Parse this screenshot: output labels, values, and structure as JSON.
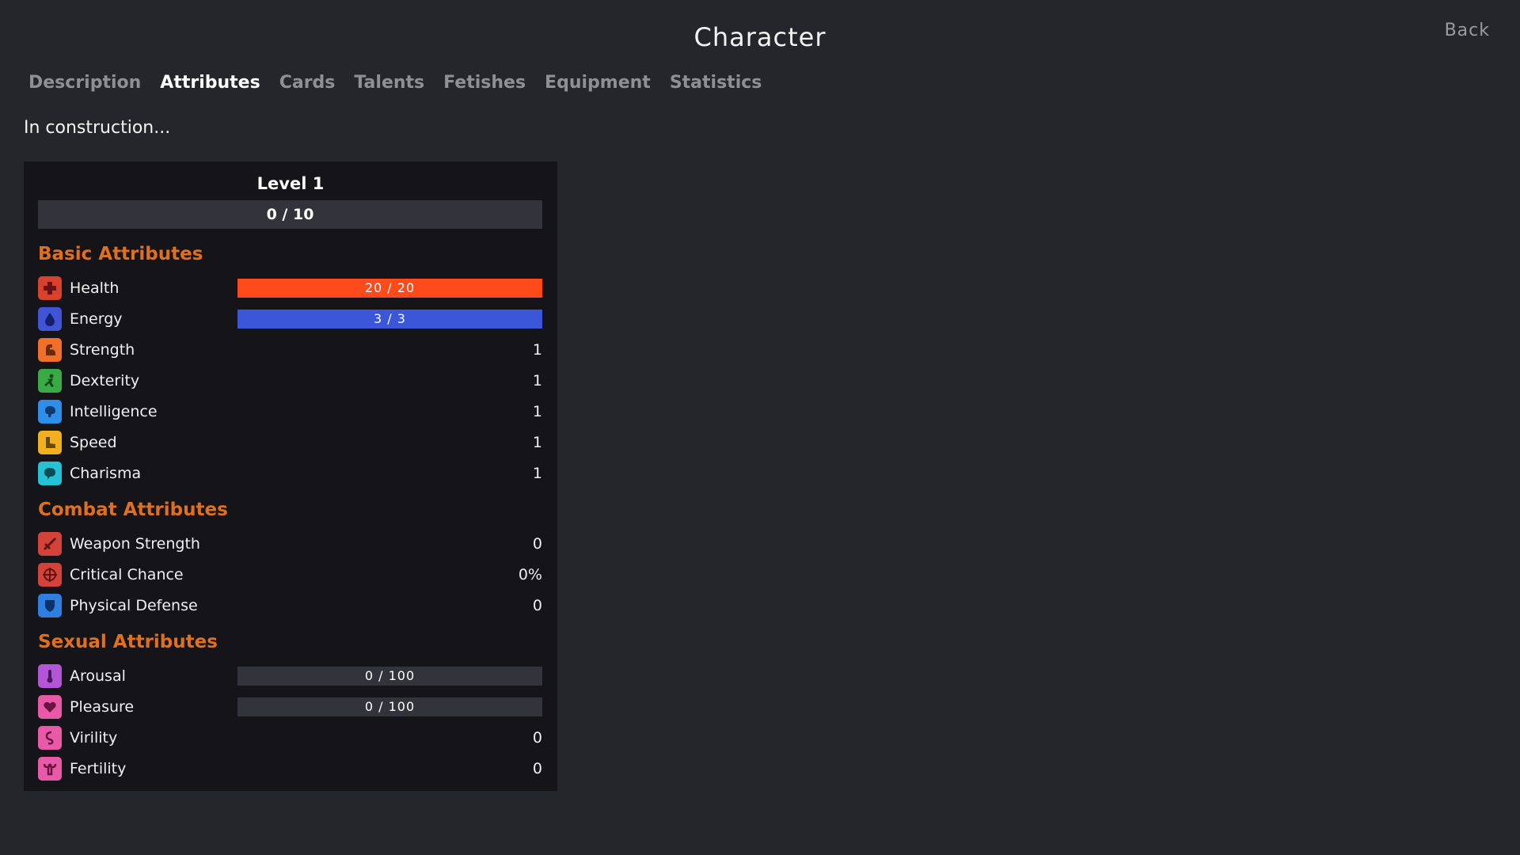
{
  "header": {
    "title": "Character",
    "back_label": "Back"
  },
  "tabs": [
    "Description",
    "Attributes",
    "Cards",
    "Talents",
    "Fetishes",
    "Equipment",
    "Statistics"
  ],
  "active_tab": "Attributes",
  "notice": "In construction...",
  "level": {
    "title": "Level 1",
    "xp_text": "0 / 10",
    "xp_fraction": 0
  },
  "sections": {
    "basic": {
      "title": "Basic Attributes",
      "health": {
        "label": "Health",
        "bar_text": "20 / 20",
        "fraction": 1.0,
        "color": "#ff4a1c",
        "icon": "health-cross-icon",
        "icon_color": "#d8412c"
      },
      "energy": {
        "label": "Energy",
        "bar_text": "3 / 3",
        "fraction": 1.0,
        "color": "#3b56d9",
        "icon": "energy-drop-icon",
        "icon_color": "#3f55d6"
      },
      "strength": {
        "label": "Strength",
        "value": "1",
        "icon": "strength-arm-icon",
        "icon_color": "#f0702a"
      },
      "dexterity": {
        "label": "Dexterity",
        "value": "1",
        "icon": "dexterity-figure-icon",
        "icon_color": "#3aaa45"
      },
      "intelligence": {
        "label": "Intelligence",
        "value": "1",
        "icon": "intelligence-brain-icon",
        "icon_color": "#2f8ee8"
      },
      "speed": {
        "label": "Speed",
        "value": "1",
        "icon": "speed-boot-icon",
        "icon_color": "#f2b01f"
      },
      "charisma": {
        "label": "Charisma",
        "value": "1",
        "icon": "charisma-speech-icon",
        "icon_color": "#25c2d6"
      }
    },
    "combat": {
      "title": "Combat Attributes",
      "weapon_strength": {
        "label": "Weapon Strength",
        "value": "0",
        "icon": "sword-icon",
        "icon_color": "#d4433a"
      },
      "critical_chance": {
        "label": "Critical Chance",
        "value": "0%",
        "icon": "crosshair-icon",
        "icon_color": "#d4433a"
      },
      "physical_defense": {
        "label": "Physical Defense",
        "value": "0",
        "icon": "shield-icon",
        "icon_color": "#2f7fe0"
      }
    },
    "sexual": {
      "title": "Sexual Attributes",
      "arousal": {
        "label": "Arousal",
        "bar_text": "0 / 100",
        "fraction": 0,
        "icon": "thermometer-icon",
        "icon_color": "#b455d8"
      },
      "pleasure": {
        "label": "Pleasure",
        "bar_text": "0 / 100",
        "fraction": 0,
        "icon": "heart-icon",
        "icon_color": "#e85aa8"
      },
      "virility": {
        "label": "Virility",
        "value": "0",
        "icon": "virility-icon",
        "icon_color": "#e85aa8"
      },
      "fertility": {
        "label": "Fertility",
        "value": "0",
        "icon": "fertility-icon",
        "icon_color": "#e85aa8"
      }
    }
  }
}
